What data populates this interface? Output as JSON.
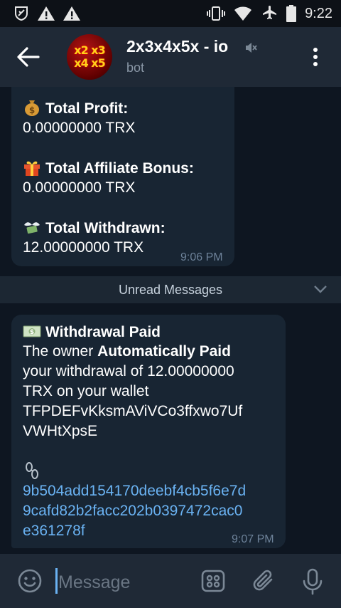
{
  "status_bar": {
    "time": "9:22",
    "left_icons": [
      "shield-alert-icon",
      "warning-icon",
      "warning-icon"
    ],
    "right_icons": [
      "vibrate-icon",
      "wifi-icon",
      "airplane-icon",
      "battery-icon"
    ]
  },
  "header": {
    "title": "2x3x4x5x - io",
    "subtitle": "bot",
    "avatar_text": [
      "x2 x3",
      "x4 x5"
    ],
    "muted": true
  },
  "messages": [
    {
      "lines": [
        {
          "emoji": "money-bag-icon",
          "text": "Total Profit:",
          "bold": true
        },
        {
          "text": "0.00000000 TRX"
        },
        {
          "emoji": "gift-icon",
          "text": "Total Affiliate Bonus:",
          "bold": true
        },
        {
          "text": "0.00000000 TRX"
        },
        {
          "emoji": "money-wings-icon",
          "text": "Total Withdrawn:",
          "bold": true
        },
        {
          "text": "12.00000000 TRX"
        }
      ],
      "time": "9:06 PM"
    },
    {
      "title": "Withdrawal Paid",
      "title_emoji": "dollar-banknote-icon",
      "body_prefix": "The owner ",
      "body_bold": "Automatically Paid",
      "body_lines": [
        "your withdrawal of 12.00000000",
        "TRX on your wallet",
        "TFPDEFvKksmAViVCo3ffxwo7Uf",
        "VWHtXpsE"
      ],
      "link_emoji": "chain-icon",
      "tx_hash_lines": [
        "9b504add154170deebf4cb5f6e7d",
        "9cafd82b2facc202b0397472cac0",
        "e361278f"
      ],
      "time": "9:07 PM"
    }
  ],
  "unread_divider": "Unread Messages",
  "input": {
    "placeholder": "Message"
  },
  "colors": {
    "background": "#0e1621",
    "header": "#1f2936",
    "bubble": "#182533",
    "link": "#6ab2f2"
  }
}
